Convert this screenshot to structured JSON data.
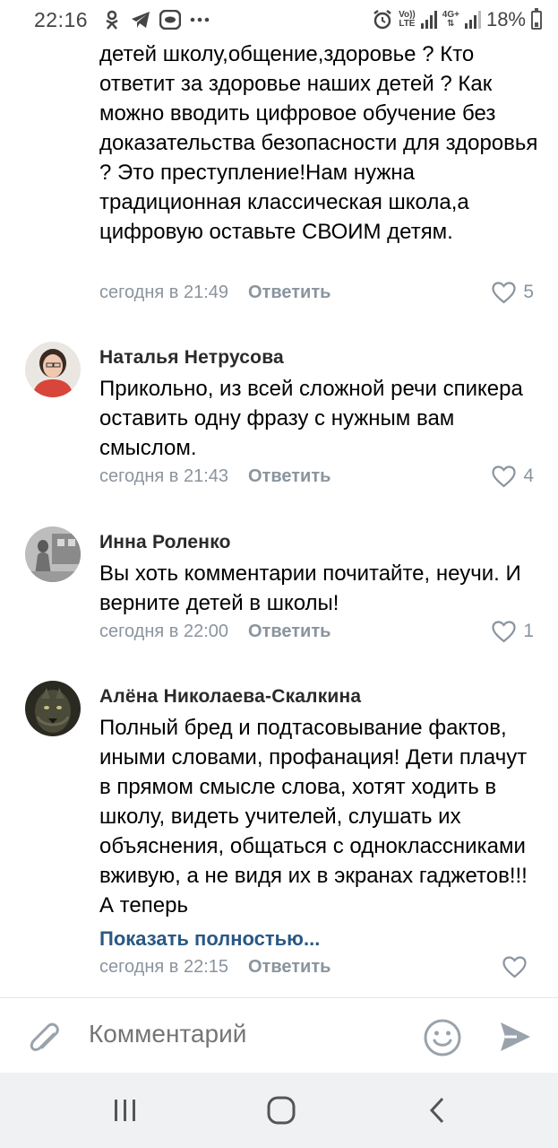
{
  "status_bar": {
    "time": "22:16",
    "lte_top": "Vo))",
    "lte_bottom": "LTE",
    "net_top": "4G+",
    "battery": "18%"
  },
  "comments": [
    {
      "author": "",
      "text": "детей школу,общение,здоровье ? Кто ответит за здоровье наших детей ? Как можно вводить цифровое обучение без доказательства безопасности для здоровья ? Это преступление!Нам нужна традиционная классическая школа,а цифровую оставьте СВОИМ детям.",
      "date": "сегодня в 21:49",
      "reply": "Ответить",
      "likes": "5"
    },
    {
      "author": "Наталья Нетрусова",
      "text": "Прикольно, из всей сложной речи спикера оставить одну фразу с нужным вам смыслом.",
      "date": "сегодня в 21:43",
      "reply": "Ответить",
      "likes": "4"
    },
    {
      "author": "Инна Роленко",
      "text": "Вы хоть комментарии почитайте, неучи. И верните детей в школы!",
      "date": "сегодня в 22:00",
      "reply": "Ответить",
      "likes": "1"
    },
    {
      "author": "Алёна Николаева-Скалкина",
      "text": "Полный бред и подтасовывание фактов, иными словами, профанация! Дети плачут в прямом смысле слова, хотят ходить в школу, видеть учителей, слушать их объяснения, общаться с одноклассниками вживую, а не видя их в экранах гаджетов!!! А теперь",
      "show_more": "Показать полностью...",
      "date": "сегодня в 22:15",
      "reply": "Ответить",
      "likes": ""
    }
  ],
  "composer": {
    "placeholder": "Комментарий",
    "attach_icon": "paperclip-icon",
    "emoji_icon": "smiley-icon",
    "send_icon": "send-arrow-icon"
  },
  "navbar": {
    "recents_icon": "recents-icon",
    "home_icon": "home-icon",
    "back_icon": "back-icon"
  },
  "colors": {
    "meta": "#8a949e",
    "link": "#2a5885",
    "text": "#000000",
    "navbar_bg": "#f0f1f2"
  }
}
